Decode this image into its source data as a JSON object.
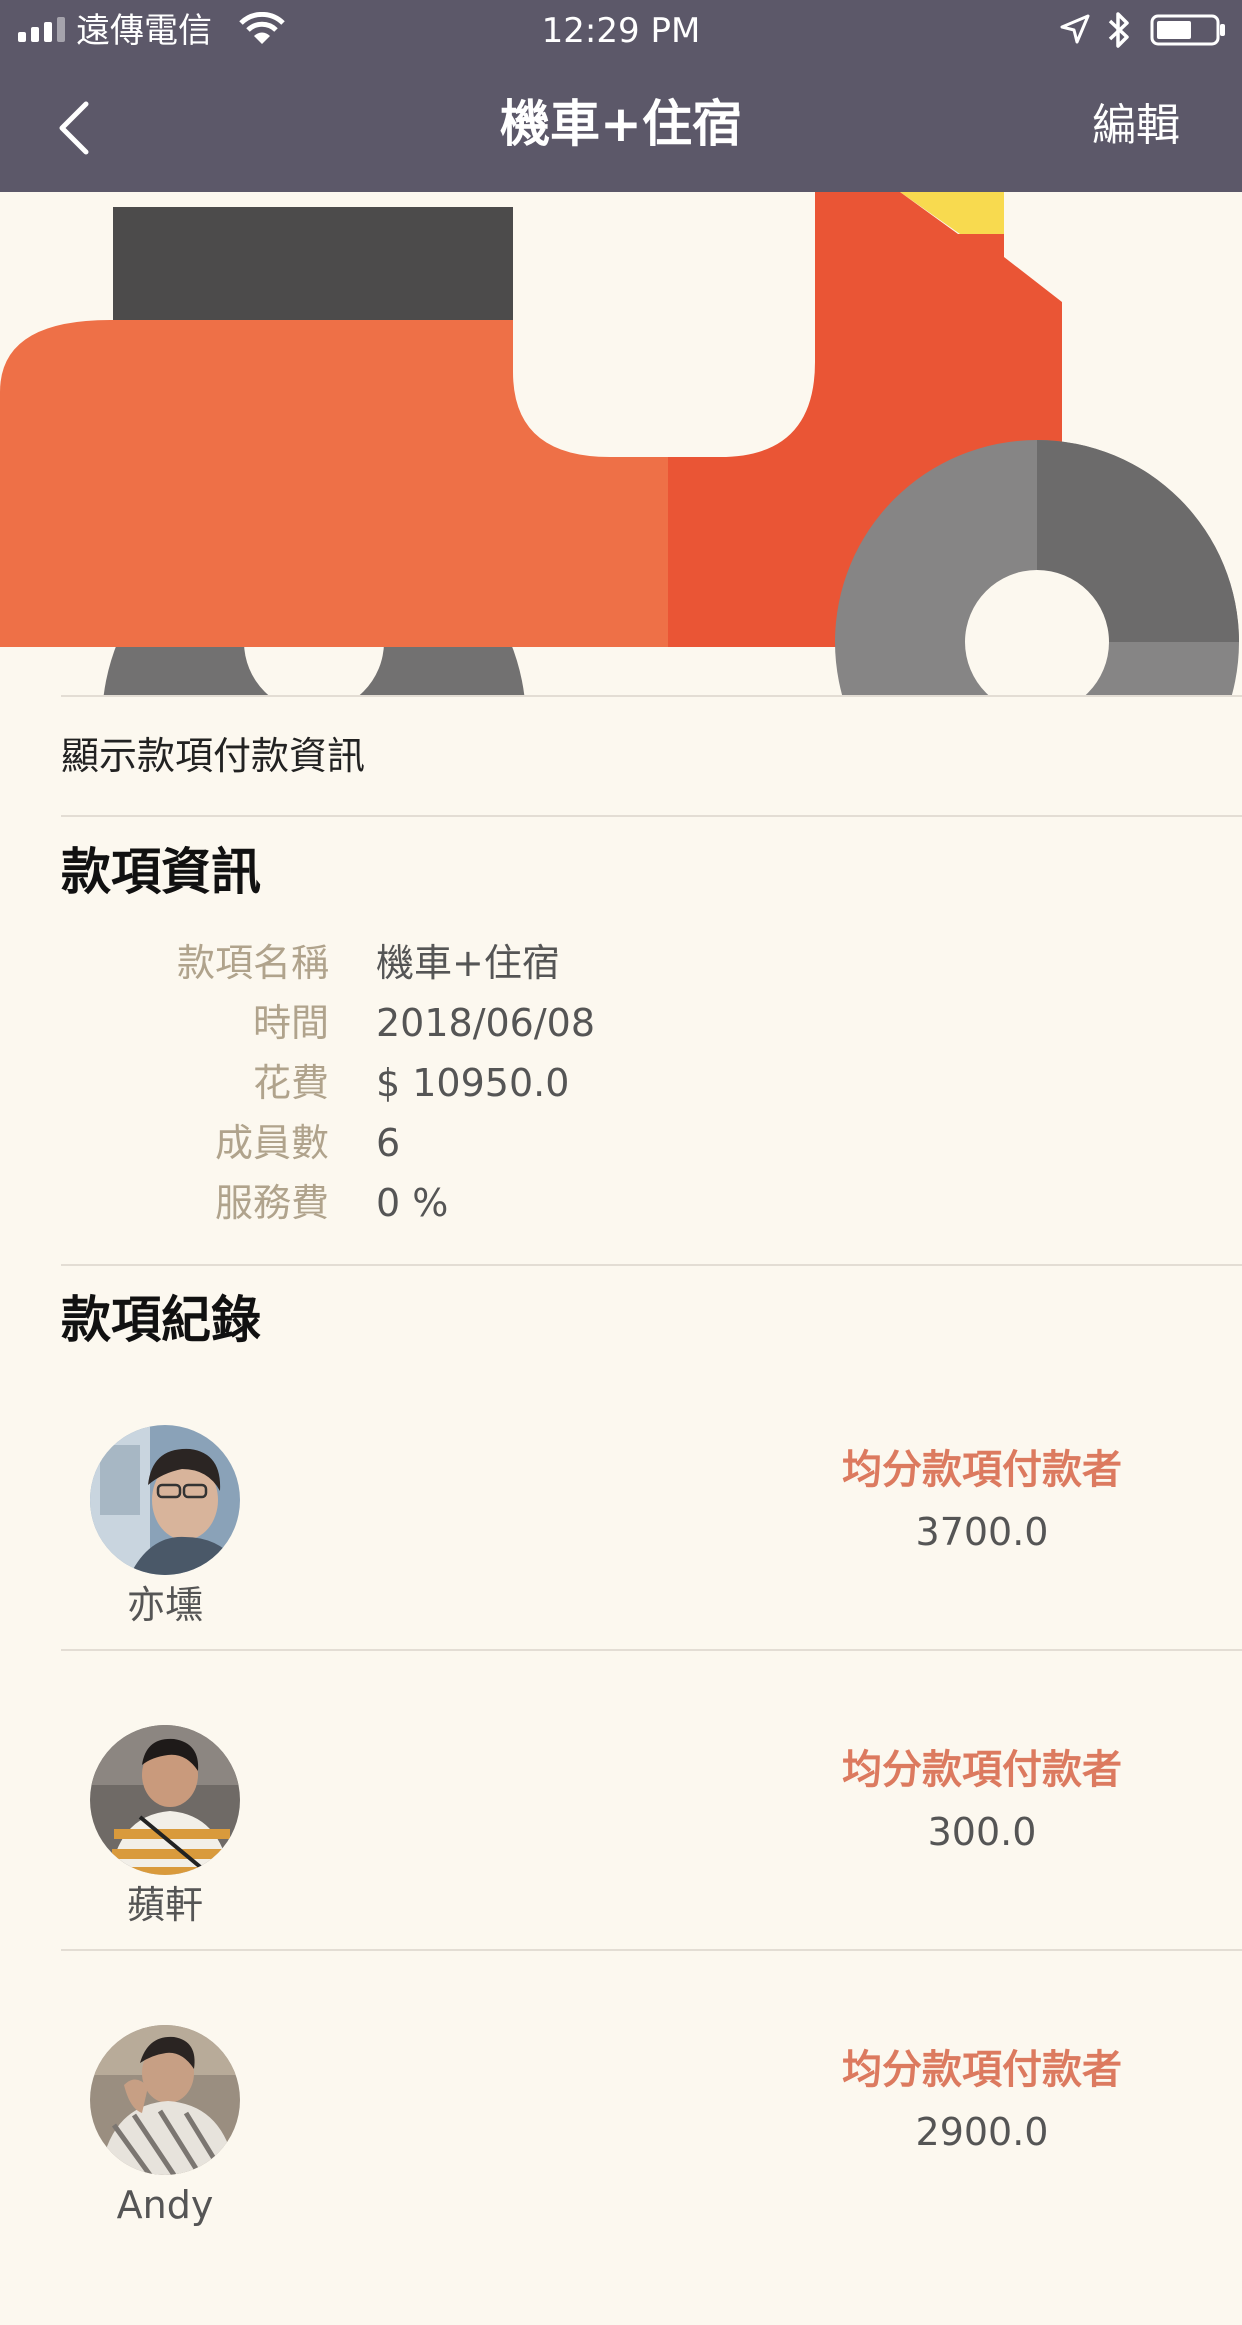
{
  "status_bar": {
    "carrier": "遠傳電信",
    "time": "12:29 PM",
    "icons": [
      "signal-icon",
      "wifi-icon",
      "location-arrow-icon",
      "bluetooth-icon",
      "battery-icon"
    ]
  },
  "nav": {
    "title": "機車+住宿",
    "edit_label": "編輯",
    "back_icon": "chevron-left-icon"
  },
  "hero": {
    "illustration": "scooter"
  },
  "show_info_label": "顯示款項付款資訊",
  "info_section": {
    "title": "款項資訊",
    "rows": [
      {
        "label": "款項名稱",
        "value": "機車+住宿"
      },
      {
        "label": "時間",
        "value": "2018/06/08"
      },
      {
        "label": "花費",
        "value": "$ 10950.0"
      },
      {
        "label": "成員數",
        "value": "6"
      },
      {
        "label": "服務費",
        "value": "0 %"
      }
    ]
  },
  "records_section": {
    "title": "款項紀錄",
    "records": [
      {
        "name": "亦壎",
        "role": "均分款項付款者",
        "amount": "3700.0"
      },
      {
        "name": "蘋軒",
        "role": "均分款項付款者",
        "amount": "300.0"
      },
      {
        "name": "Andy",
        "role": "均分款項付款者",
        "amount": "2900.0"
      }
    ]
  },
  "colors": {
    "nav_bg": "#5c5869",
    "page_bg": "#fcf8ef",
    "label": "#b0a38c",
    "role": "#dc7a5f"
  }
}
